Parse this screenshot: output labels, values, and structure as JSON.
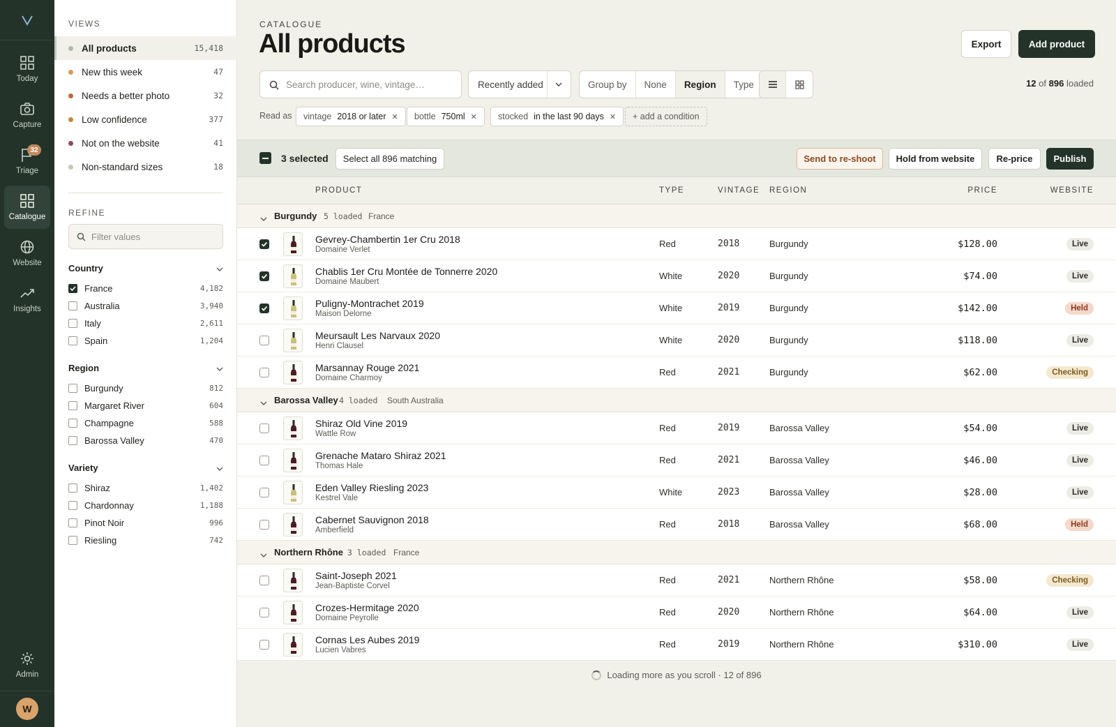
{
  "rail": {
    "logo": "V",
    "items": [
      {
        "label": "Today",
        "icon": "dashboard-icon"
      },
      {
        "label": "Capture",
        "icon": "camera-icon"
      },
      {
        "label": "Triage",
        "icon": "flag-icon",
        "badge": "32"
      },
      {
        "label": "Catalogue",
        "icon": "grid-icon",
        "active": true
      },
      {
        "label": "Website",
        "icon": "globe-icon"
      },
      {
        "label": "Insights",
        "icon": "trend-icon"
      }
    ],
    "admin_label": "Admin",
    "avatar_initial": "W"
  },
  "views": {
    "title": "VIEWS",
    "items": [
      {
        "label": "All products",
        "count": "15,418",
        "dot": "#b9b7aa"
      },
      {
        "label": "New this week",
        "count": "47",
        "dot": "#d49a5a"
      },
      {
        "label": "Needs a better photo",
        "count": "32",
        "dot": "#c0683f"
      },
      {
        "label": "Low confidence",
        "count": "377",
        "dot": "#c0883f"
      },
      {
        "label": "Not on the website",
        "count": "41",
        "dot": "#8a4a5a"
      },
      {
        "label": "Non-standard sizes",
        "count": "18",
        "dot": "#c9c6b6"
      }
    ]
  },
  "refine": {
    "title": "REFINE",
    "filter_placeholder": "Filter values",
    "facets": [
      {
        "title": "Country",
        "options": [
          {
            "label": "France",
            "count": "4,182",
            "checked": true
          },
          {
            "label": "Australia",
            "count": "3,940"
          },
          {
            "label": "Italy",
            "count": "2,611"
          },
          {
            "label": "Spain",
            "count": "1,204"
          }
        ]
      },
      {
        "title": "Region",
        "options": [
          {
            "label": "Burgundy",
            "count": "812"
          },
          {
            "label": "Margaret River",
            "count": "604"
          },
          {
            "label": "Champagne",
            "count": "588"
          },
          {
            "label": "Barossa Valley",
            "count": "470"
          }
        ]
      },
      {
        "title": "Variety",
        "options": [
          {
            "label": "Shiraz",
            "count": "1,402"
          },
          {
            "label": "Chardonnay",
            "count": "1,188"
          },
          {
            "label": "Pinot Noir",
            "count": "996"
          },
          {
            "label": "Riesling",
            "count": "742"
          }
        ]
      }
    ]
  },
  "header": {
    "crumb": "CATALOGUE",
    "title": "All products",
    "export_label": "Export",
    "add_label": "Add product"
  },
  "toolbar": {
    "search_placeholder": "Search producer, wine, vintage…",
    "sort_label": "Recently added",
    "group_by_label": "Group by",
    "group_options": [
      "None",
      "Region",
      "Type"
    ],
    "group_selected": "Region",
    "loaded_count": "12",
    "loaded_of": "of",
    "total": "896",
    "loaded_suffix": "loaded"
  },
  "conditions": {
    "read_as": "Read as",
    "chips": [
      {
        "key": "vintage",
        "value": "2018 or later"
      },
      {
        "key": "bottle",
        "value": "750ml"
      },
      {
        "key": "stocked",
        "value": "in the last 90 days"
      }
    ],
    "add_label": "+ add a condition"
  },
  "selection": {
    "text": "3 selected",
    "select_all": "Select all 896 matching",
    "actions": [
      "Send to re-shoot",
      "Hold from website",
      "Re-price",
      "Publish"
    ]
  },
  "columns": [
    "PRODUCT",
    "TYPE",
    "VINTAGE",
    "REGION",
    "PRICE",
    "WEBSITE"
  ],
  "groups": [
    {
      "name": "Burgundy",
      "loaded": "5 loaded",
      "country": "France",
      "rows": [
        {
          "name": "Gevrey-Chambertin 1er Cru 2018",
          "producer": "Domaine Verlet",
          "type": "Red",
          "vintage": "2018",
          "region": "Burgundy",
          "price": "$128.00",
          "status": "Live",
          "checked": true
        },
        {
          "name": "Chablis 1er Cru Montée de Tonnerre 2020",
          "producer": "Domaine Maubert",
          "type": "White",
          "vintage": "2020",
          "region": "Burgundy",
          "price": "$74.00",
          "status": "Live",
          "checked": true
        },
        {
          "name": "Puligny-Montrachet 2019",
          "producer": "Maison Delorne",
          "type": "White",
          "vintage": "2019",
          "region": "Burgundy",
          "price": "$142.00",
          "status": "Held",
          "checked": true
        },
        {
          "name": "Meursault Les Narvaux 2020",
          "producer": "Henri Clausel",
          "type": "White",
          "vintage": "2020",
          "region": "Burgundy",
          "price": "$118.00",
          "status": "Live"
        },
        {
          "name": "Marsannay Rouge 2021",
          "producer": "Domaine Charmoy",
          "type": "Red",
          "vintage": "2021",
          "region": "Burgundy",
          "price": "$62.00",
          "status": "Checking"
        }
      ]
    },
    {
      "name": "Barossa Valley",
      "loaded": "4 loaded",
      "country": "South Australia",
      "rows": [
        {
          "name": "Shiraz Old Vine 2019",
          "producer": "Wattle Row",
          "type": "Red",
          "vintage": "2019",
          "region": "Barossa Valley",
          "price": "$54.00",
          "status": "Live"
        },
        {
          "name": "Grenache Mataro Shiraz 2021",
          "producer": "Thomas Hale",
          "type": "Red",
          "vintage": "2021",
          "region": "Barossa Valley",
          "price": "$46.00",
          "status": "Live"
        },
        {
          "name": "Eden Valley Riesling 2023",
          "producer": "Kestrel Vale",
          "type": "White",
          "vintage": "2023",
          "region": "Barossa Valley",
          "price": "$28.00",
          "status": "Live"
        },
        {
          "name": "Cabernet Sauvignon 2018",
          "producer": "Amberfield",
          "type": "Red",
          "vintage": "2018",
          "region": "Barossa Valley",
          "price": "$68.00",
          "status": "Held"
        }
      ]
    },
    {
      "name": "Northern Rhône",
      "loaded": "3 loaded",
      "country": "France",
      "rows": [
        {
          "name": "Saint-Joseph 2021",
          "producer": "Jean-Baptiste Corvel",
          "type": "Red",
          "vintage": "2021",
          "region": "Northern Rhône",
          "price": "$58.00",
          "status": "Checking"
        },
        {
          "name": "Crozes-Hermitage 2020",
          "producer": "Domaine Peyrolle",
          "type": "Red",
          "vintage": "2020",
          "region": "Northern Rhône",
          "price": "$64.00",
          "status": "Live"
        },
        {
          "name": "Cornas Les Aubes 2019",
          "producer": "Lucien Vabres",
          "type": "Red",
          "vintage": "2019",
          "region": "Northern Rhône",
          "price": "$310.00",
          "status": "Live"
        }
      ]
    }
  ],
  "footer": {
    "loading_text": "Loading more as you scroll · 12 of 896"
  },
  "colors": {
    "accent": "#23332a",
    "held": "#f4d9cc",
    "checking": "#f4e8cf",
    "live": "#ecebe4"
  }
}
